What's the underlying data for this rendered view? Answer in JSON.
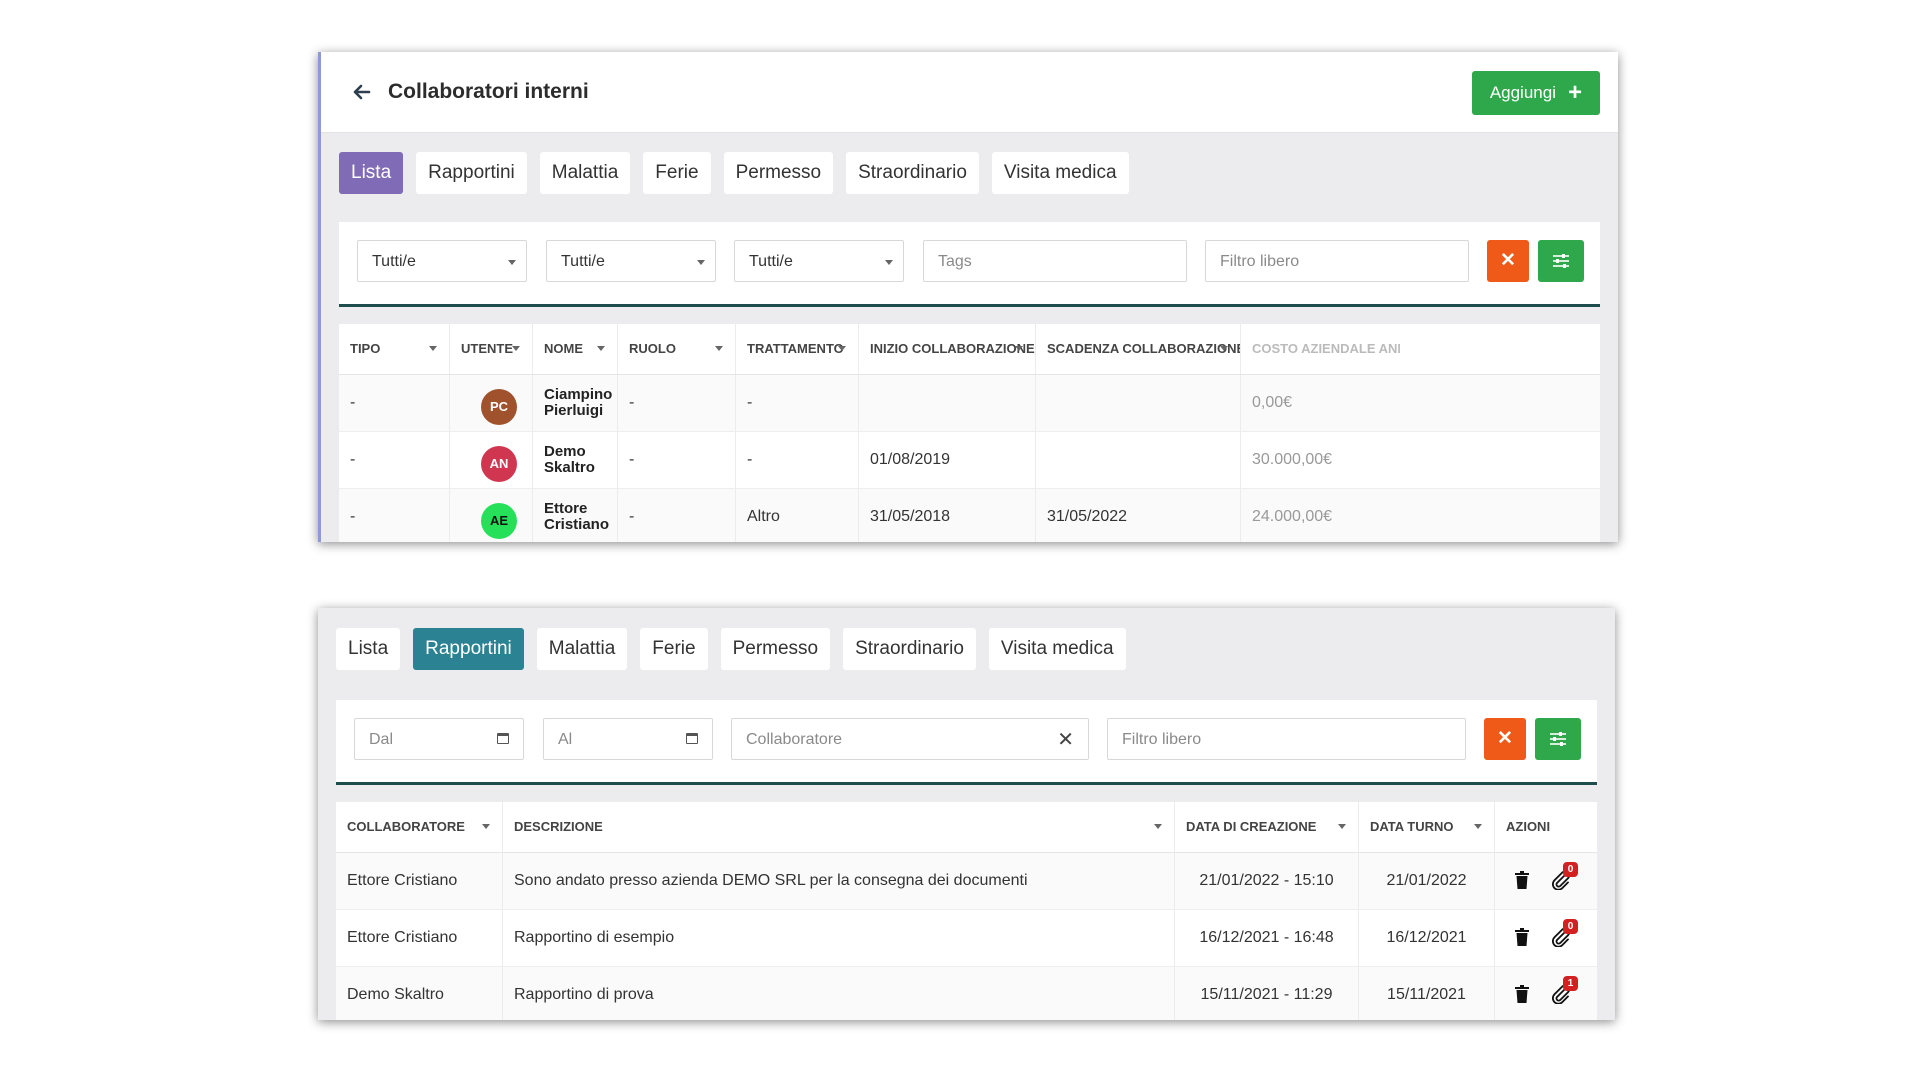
{
  "panel1": {
    "title": "Collaboratori interni",
    "add_button": "Aggiungi",
    "tabs": [
      "Lista",
      "Rapportini",
      "Malattia",
      "Ferie",
      "Permesso",
      "Straordinario",
      "Visita medica"
    ],
    "active_tab": "Lista",
    "filters": {
      "select1": "Tutti/e",
      "select2": "Tutti/e",
      "select3": "Tutti/e",
      "tags_placeholder": "Tags",
      "free_filter_placeholder": "Filtro libero"
    },
    "table": {
      "headers": [
        "TIPO",
        "UTENTE",
        "NOME",
        "RUOLO",
        "TRATTAMENTO",
        "INIZIO COLLABORAZIONE",
        "SCADENZA COLLABORAZIONE",
        "COSTO AZIENDALE ANNU"
      ],
      "rows": [
        {
          "tipo": "-",
          "initials": "PC",
          "avatar_color": "#a0522d",
          "nome": "Ciampino Pierluigi",
          "ruolo": "-",
          "trattamento": "-",
          "inizio": "",
          "scadenza": "",
          "costo": "0,00€"
        },
        {
          "tipo": "-",
          "initials": "AN",
          "avatar_color": "#d13650",
          "nome": "Demo Skaltro",
          "ruolo": "-",
          "trattamento": "-",
          "inizio": "01/08/2019",
          "scadenza": "",
          "costo": "30.000,00€"
        },
        {
          "tipo": "-",
          "initials": "AE",
          "avatar_color": "#27e05a",
          "nome": "Ettore Cristiano",
          "ruolo": "-",
          "trattamento": "Altro",
          "inizio": "31/05/2018",
          "scadenza": "31/05/2022",
          "costo": "24.000,00€"
        }
      ]
    }
  },
  "panel2": {
    "tabs": [
      "Lista",
      "Rapportini",
      "Malattia",
      "Ferie",
      "Permesso",
      "Straordinario",
      "Visita medica"
    ],
    "active_tab": "Rapportini",
    "filters": {
      "from_placeholder": "Dal",
      "to_placeholder": "Al",
      "collaborator_placeholder": "Collaboratore",
      "free_filter_placeholder": "Filtro libero"
    },
    "table": {
      "headers": [
        "COLLABORATORE",
        "DESCRIZIONE",
        "DATA DI CREAZIONE",
        "DATA TURNO",
        "AZIONI"
      ],
      "rows": [
        {
          "collaboratore": "Ettore Cristiano",
          "descrizione": "Sono andato presso azienda DEMO SRL per la consegna dei documenti",
          "creazione": "21/01/2022 - 15:10",
          "turno": "21/01/2022",
          "attachments": "0"
        },
        {
          "collaboratore": "Ettore Cristiano",
          "descrizione": "Rapportino di esempio",
          "creazione": "16/12/2021 - 16:48",
          "turno": "16/12/2021",
          "attachments": "0"
        },
        {
          "collaboratore": "Demo Skaltro",
          "descrizione": "Rapportino di prova",
          "creazione": "15/11/2021 - 11:29",
          "turno": "15/11/2021",
          "attachments": "1"
        }
      ]
    }
  }
}
